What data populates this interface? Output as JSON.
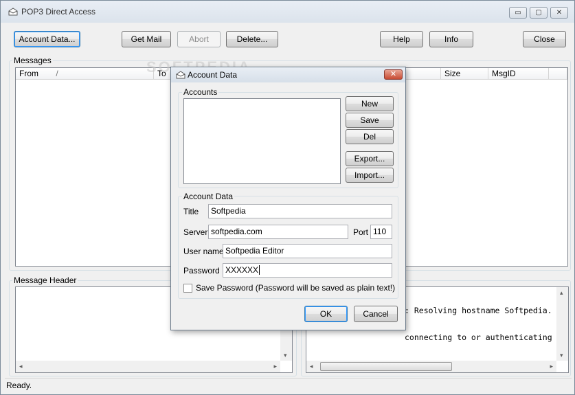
{
  "window": {
    "title": "POP3 Direct Access",
    "minimize_glyph": "▭",
    "maximize_glyph": "▢",
    "close_glyph": "✕"
  },
  "toolbar": {
    "account_data": "Account Data...",
    "get_mail": "Get Mail",
    "abort": "Abort",
    "delete": "Delete...",
    "help": "Help",
    "info": "Info",
    "close": "Close"
  },
  "messages": {
    "group_label": "Messages",
    "columns": [
      "From",
      "To",
      "Size",
      "MsgID"
    ],
    "sort_glyph": "/"
  },
  "message_header": {
    "group_label": "Message Header"
  },
  "log": {
    "lines": [
      ": Resolving hostname Softpedia.",
      "connecting to or authenticating"
    ]
  },
  "status": {
    "text": "Ready."
  },
  "watermark": "SOFTPEDIA",
  "dialog": {
    "title": "Account Data",
    "close_glyph": "✕",
    "accounts_label": "Accounts",
    "new": "New",
    "save": "Save",
    "del": "Del",
    "export": "Export...",
    "import": "Import...",
    "account_data_label": "Account Data",
    "title_label": "Title",
    "title_value": "Softpedia",
    "server_label": "Server",
    "server_value": "softpedia.com",
    "port_label": "Port",
    "port_value": "110",
    "username_label": "User name",
    "username_value": "Softpedia Editor",
    "password_label": "Password",
    "password_value": "XXXXXX",
    "save_password_label": "Save Password (Password will be saved as plain text!)",
    "ok": "OK",
    "cancel": "Cancel"
  },
  "colors": {
    "accent_focus": "#3399ff",
    "close_red": "#c84b33",
    "window_bg": "#f0f0f0"
  },
  "icons": [
    "mail-icon",
    "minimize-icon",
    "maximize-icon",
    "close-icon",
    "sort-arrow-icon",
    "scroll-left-icon",
    "scroll-right-icon",
    "scroll-down-icon",
    "scroll-up-icon"
  ]
}
